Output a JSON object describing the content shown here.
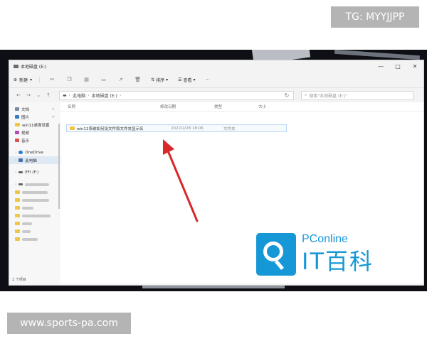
{
  "watermarks": {
    "telegram": "TG: MYYJJPP",
    "site": "www.sports-pa.com"
  },
  "window": {
    "title": "本地磁盘 (E:)",
    "controls": [
      "—",
      "□",
      "✕"
    ]
  },
  "toolbar": {
    "new_label": "新建",
    "sort_label": "排序",
    "view_label": "查看",
    "more_label": "···",
    "icons": [
      "cut-icon",
      "copy-icon",
      "paste-icon",
      "rename-icon",
      "share-icon",
      "delete-icon"
    ]
  },
  "address": {
    "path_root": "此电脑",
    "path_leaf": "本地磁盘 (E:)",
    "search_placeholder": "搜索\"本地磁盘 (E:)\""
  },
  "columns": {
    "name": "名称",
    "modified": "修改日期",
    "type": "类型",
    "size": "大小"
  },
  "rows": [
    {
      "name": "win11系统如何设文件和文件夹显示名",
      "modified": "2022/2/28 18:06",
      "type": "文件夹",
      "size": ""
    }
  ],
  "sidebar": {
    "items": [
      {
        "label": "文档",
        "icon": "document-icon",
        "color": "#7a8aa0",
        "pinned": true
      },
      {
        "label": "图片",
        "icon": "picture-icon",
        "color": "#3b78c4",
        "pinned": true
      },
      {
        "label": "win11桌面设置",
        "icon": "folder-icon",
        "color": "#f0c548",
        "pinned": false
      },
      {
        "label": "视频",
        "icon": "video-icon",
        "color": "#b04db5",
        "pinned": false
      },
      {
        "label": "音乐",
        "icon": "music-icon",
        "color": "#d9534f",
        "pinned": false
      }
    ],
    "onedrive": "OneDrive",
    "this_pc": "此电脑",
    "drive": "EFI (F:)",
    "status": "1 个项目"
  },
  "logo": {
    "word": "PConline",
    "cn": "IT百科",
    "color": "#1798d6"
  },
  "accent": {
    "arrow": "#d8282a",
    "selection": "#dfe9f5"
  }
}
